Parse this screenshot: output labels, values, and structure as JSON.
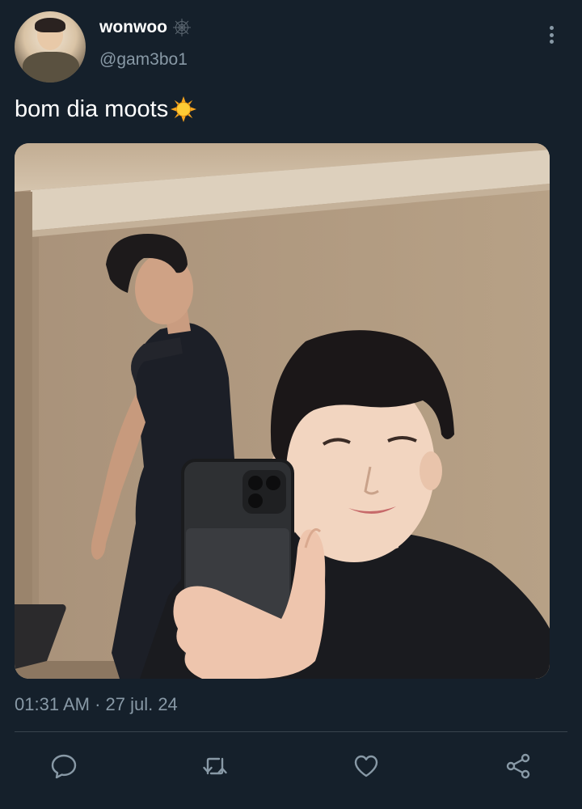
{
  "user": {
    "display_name": "wonwoo",
    "name_emoji": "spider-web-icon",
    "handle": "@gam3bo1"
  },
  "tweet": {
    "text": "bom dia moots",
    "text_emoji": "sun-icon",
    "timestamp": "01:31 AM · 27 jul. 24"
  },
  "actions": [
    {
      "name": "reply",
      "icon": "comment-icon"
    },
    {
      "name": "retweet",
      "icon": "retweet-icon"
    },
    {
      "name": "like",
      "icon": "heart-icon"
    },
    {
      "name": "share",
      "icon": "share-icon"
    }
  ],
  "colors": {
    "background": "#15202b",
    "secondary_text": "#8899a6",
    "divider": "#38444d"
  }
}
